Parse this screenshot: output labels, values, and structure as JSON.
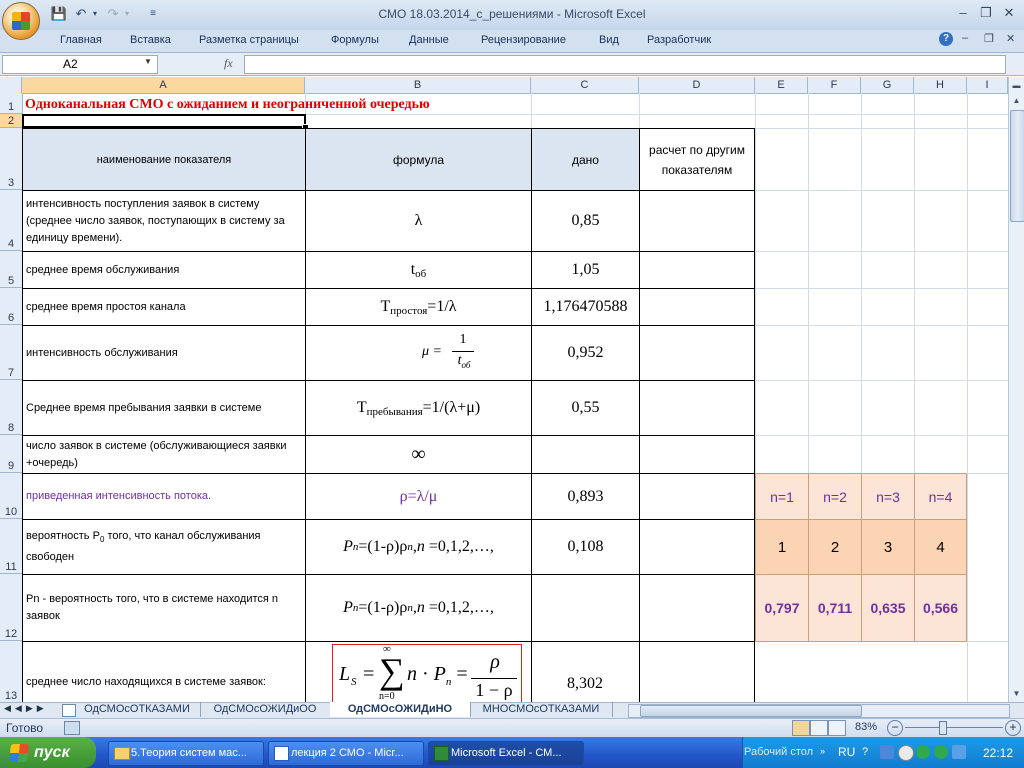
{
  "window": {
    "title": "СМО 18.03.2014_с_решениями - Microsoft Excel"
  },
  "ribbon_tabs": [
    "Главная",
    "Вставка",
    "Разметка страницы",
    "Формулы",
    "Данные",
    "Рецензирование",
    "Вид",
    "Разработчик"
  ],
  "formula_bar": {
    "name_box": "A2",
    "fx": "fx",
    "value": ""
  },
  "columns": [
    "A",
    "B",
    "C",
    "D",
    "E",
    "F",
    "G",
    "H",
    "I"
  ],
  "rows": [
    "1",
    "2",
    "3",
    "4",
    "5",
    "6",
    "7",
    "8",
    "9",
    "10",
    "11",
    "12",
    "13"
  ],
  "sheet": {
    "title": "Одноканальная СМО с ожиданием и неограниченной очередью",
    "headers": {
      "name": "наименование показателя",
      "formula": "формула",
      "given": "дано",
      "calc": "расчет по другим показателям"
    },
    "rows": [
      {
        "name": "интенсивность поступления заявок в систему (среднее число заявок, поступающих в систему за единицу времени).",
        "formula": "λ",
        "value": "0,85"
      },
      {
        "name": "среднее время обслуживания",
        "formula": "tоб",
        "value": "1,05"
      },
      {
        "name": "среднее время простоя канала",
        "formula": "Tпростоя=1/λ",
        "value": "1,176470588"
      },
      {
        "name": "интенсивность обслуживания",
        "formula": "μ = 1/tоб",
        "value": "0,952"
      },
      {
        "name": "Среднее время пребывания заявки в системе",
        "formula": "Tпребывания=1/(λ+μ)",
        "value": "0,55"
      },
      {
        "name": "число заявок в системе (обслуживающиеся заявки +очередь)",
        "formula": "∞",
        "value": ""
      },
      {
        "name": "приведенная интенсивность потока.",
        "formula": "ρ=λ/μ",
        "value": "0,893"
      },
      {
        "name": "вероятность P0 того, что канал обслуживания свободен",
        "formula": "Pn =(1-ρ)ρn, n =0,1,2,…,",
        "value": "0,108"
      },
      {
        "name": "Pn - вероятность того, что в системе находится n заявок",
        "formula": "Pn =(1-ρ)ρn, n =0,1,2,…,",
        "value": ""
      },
      {
        "name": "среднее число находящихся в системе заявок:",
        "formula": "Ls = Σ n·Pn = ρ/(1−ρ)",
        "value": "8,302"
      }
    ],
    "n_labels": [
      "n=1",
      "n=2",
      "n=3",
      "n=4"
    ],
    "n_values": [
      "1",
      "2",
      "3",
      "4"
    ],
    "p_values": [
      "0,797",
      "0,711",
      "0,635",
      "0,566"
    ]
  },
  "formula_parts": {
    "t": "t",
    "t_sub": "об",
    "T": "T",
    "prost_sub": "простоя",
    "prost_rest": "=1/λ",
    "preb_sub": "пребывания",
    "preb_rest": "=1/(λ+μ)",
    "mu_eq": "μ =",
    "one": "1",
    "P": "P",
    "n": "n",
    "pn_rest": "=(1-ρ)ρ",
    "pn_tail": ", ",
    "pn_list": "=0,1,2,…,",
    "p0_pre": "вероятность P",
    "p0_sub": "0",
    "p0_post": " того, что канал обслуживания свободен",
    "L": "L",
    "s": "S",
    "sum": "∑",
    "inf": "∞",
    "n0": "n=0",
    "dot": "·",
    "eq": "=",
    "rho": "ρ",
    "one_minus_rho": "1 − ρ"
  },
  "sheet_tabs": [
    "ОдСМОсОТКАЗАМИ",
    "ОдСМОсОЖИДиОО",
    "ОдСМОсОЖИДиНО",
    "МНОСМОсОТКАЗАМИ"
  ],
  "active_sheet": "ОдСМОсОЖИДиНО",
  "status": {
    "ready": "Готово",
    "zoom": "83%"
  },
  "taskbar": {
    "start": "пуск",
    "tasks": [
      "5.Теория систем мас...",
      "лекция 2 СМО - Micr...",
      "Microsoft Excel - СМ..."
    ],
    "desktop": "Рабочий стол",
    "lang": "RU",
    "clock": "22:12"
  },
  "colors": {
    "accent_red": "#e00000",
    "purple": "#7030a0",
    "header_fill": "#dbe5f1",
    "peach": "#fce4d6"
  }
}
